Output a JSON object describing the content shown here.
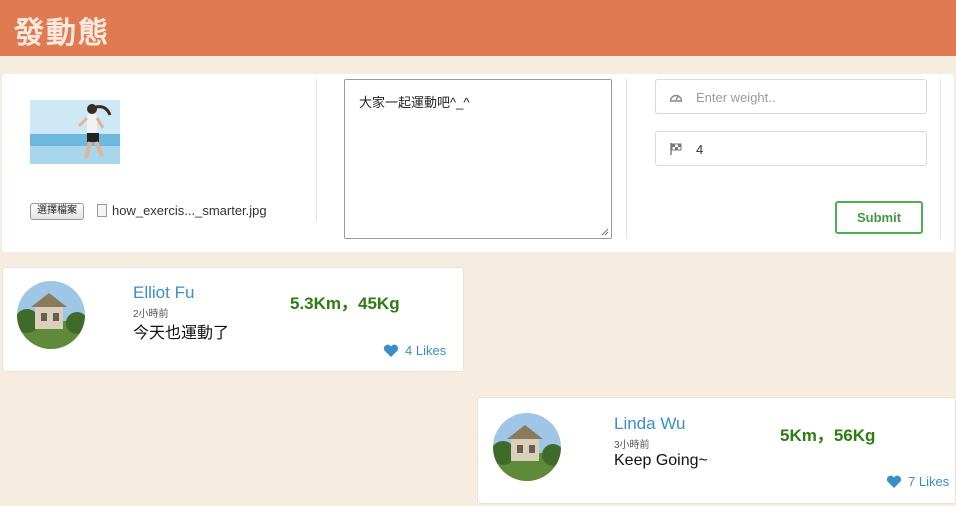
{
  "header": {
    "title": "發動態"
  },
  "composer": {
    "file_button_label": "選擇檔案",
    "file_name": "how_exercis..._smarter.jpg",
    "post_text": "大家一起運動吧^_^",
    "weight_placeholder": "Enter weight..",
    "distance_value": "4",
    "submit_label": "Submit"
  },
  "posts": [
    {
      "name": "Elliot Fu",
      "time": "2小時前",
      "message": "今天也運動了",
      "stats": "5.3Km，45Kg",
      "likes": "4 Likes"
    },
    {
      "name": "Linda Wu",
      "time": "3小時前",
      "message": "Keep Going~",
      "stats": "5Km，56Kg",
      "likes": "7 Likes"
    }
  ],
  "colors": {
    "header": "#e07a52",
    "background": "#f7ece0",
    "link": "#3a8fc8",
    "stats": "#2e7d12",
    "submit": "#4caf50"
  },
  "icons": [
    "dashboard-icon",
    "flag-icon",
    "file-icon",
    "heart-icon"
  ]
}
